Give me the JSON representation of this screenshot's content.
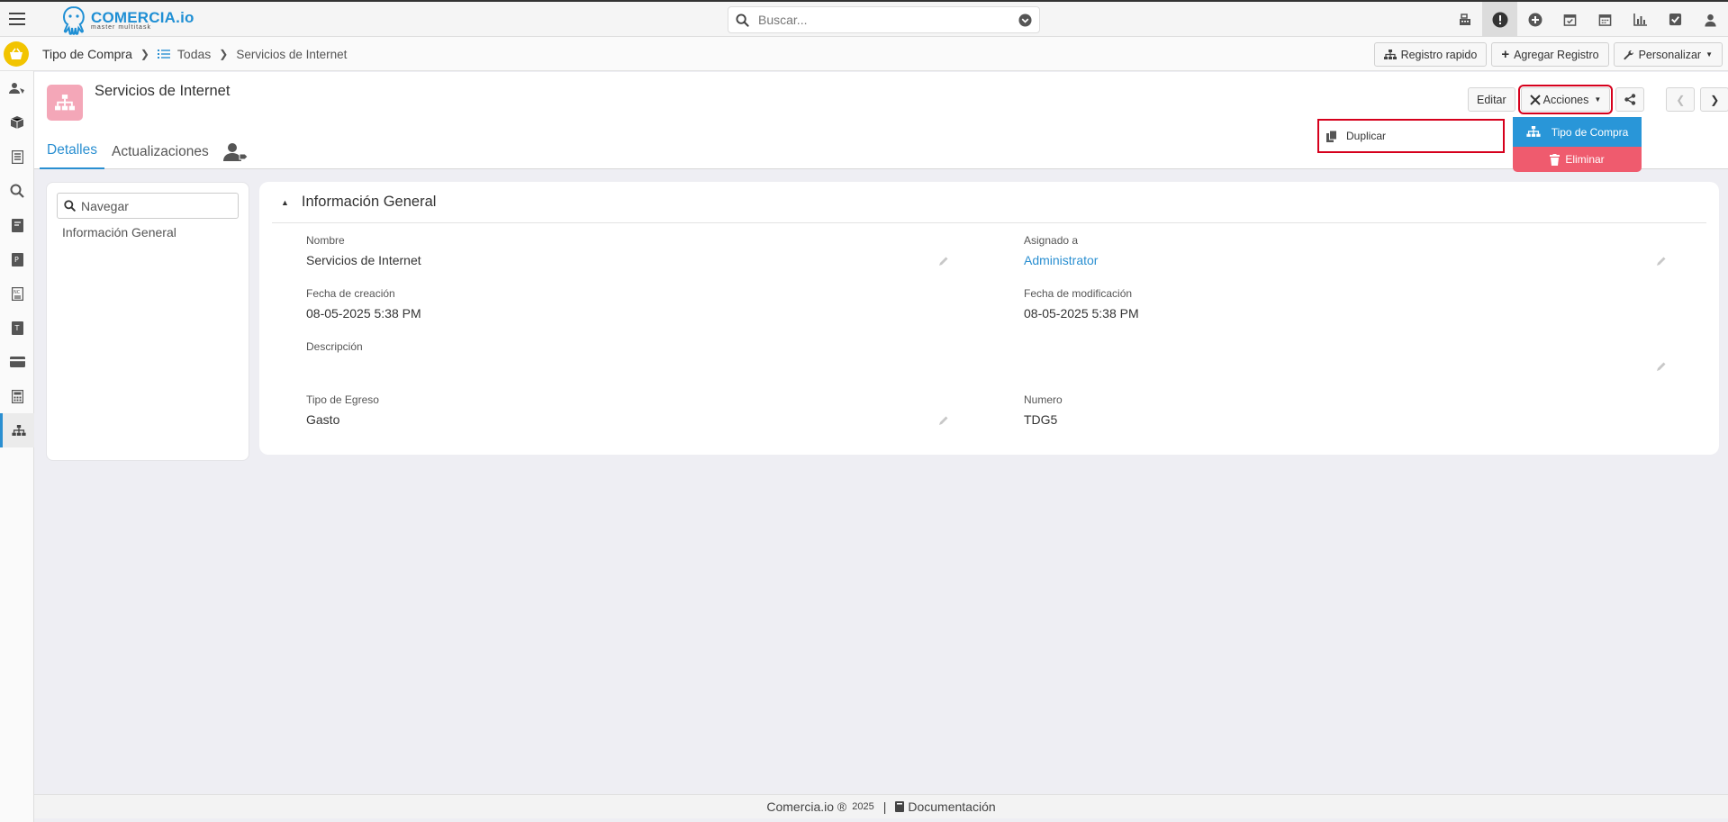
{
  "app": {
    "brand": "COMERCIA.io",
    "tagline": "master multitask"
  },
  "search": {
    "placeholder": "Buscar..."
  },
  "topbar_icons": [
    "cash-register-icon",
    "alert-icon",
    "plus-circle-icon",
    "calendar-check-icon",
    "calendar-icon",
    "bar-chart-icon",
    "check-square-icon",
    "user-icon"
  ],
  "breadcrumb": {
    "module": "Tipo de Compra",
    "list": "Todas",
    "record": "Servicios de Internet"
  },
  "crumb_actions": {
    "quick": "Registro rapido",
    "add": "Agregar Registro",
    "customize": "Personalizar"
  },
  "record": {
    "title": "Servicios de Internet"
  },
  "tabs": {
    "details": "Detalles",
    "updates": "Actualizaciones"
  },
  "header_buttons": {
    "edit": "Editar",
    "actions": "Acciones"
  },
  "actions_menu": {
    "duplicate": "Duplicar",
    "type": "Tipo de Compra",
    "delete": "Eliminar"
  },
  "nav": {
    "placeholder": "Navegar",
    "item": "Información General"
  },
  "section": {
    "title": "Información General"
  },
  "fields": {
    "nombre": {
      "label": "Nombre",
      "value": "Servicios de Internet"
    },
    "asignado": {
      "label": "Asignado a",
      "value": "Administrator"
    },
    "creacion": {
      "label": "Fecha de creación",
      "value": "08-05-2025 5:38 PM"
    },
    "modificacion": {
      "label": "Fecha de modificación",
      "value": "08-05-2025 5:38 PM"
    },
    "descripcion": {
      "label": "Descripción",
      "value": ""
    },
    "tipo_egreso": {
      "label": "Tipo de Egreso",
      "value": "Gasto"
    },
    "numero": {
      "label": "Numero",
      "value": "TDG5"
    }
  },
  "footer": {
    "brand": "Comercia.io ®",
    "year": "2025",
    "separator": "|",
    "docs": "Documentación"
  },
  "colors": {
    "accent": "#2a8fd1",
    "danger": "#ef5b6e",
    "highlight": "#d6001c",
    "module_icon": "#f4a7b8",
    "basket": "#f2c400"
  }
}
